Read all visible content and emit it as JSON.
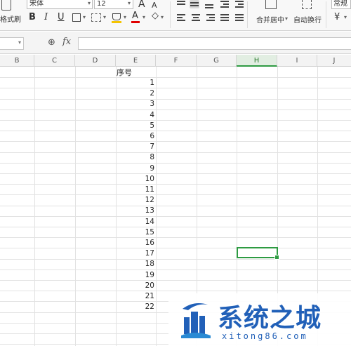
{
  "ribbon": {
    "format_painter_label": "格式刷",
    "font_name": "宋体",
    "font_size": "12",
    "bold_label": "B",
    "italic_label": "I",
    "underline_label": "U",
    "grow_font_label": "A",
    "shrink_font_label": "A",
    "merge_center_label": "合并居中",
    "wrap_text_label": "自动换行",
    "number_format_label": "常规",
    "currency_label": "¥"
  },
  "formula_bar": {
    "fx_label": "fx",
    "value": ""
  },
  "columns": [
    "B",
    "C",
    "D",
    "E",
    "F",
    "G",
    "H",
    "I",
    "J"
  ],
  "active_column": "H",
  "sheet": {
    "header": "序号",
    "numbers": [
      "1",
      "2",
      "3",
      "4",
      "5",
      "6",
      "7",
      "8",
      "9",
      "10",
      "11",
      "12",
      "13",
      "14",
      "15",
      "16",
      "17",
      "18",
      "19",
      "20",
      "21",
      "22"
    ]
  },
  "watermark": {
    "title": "系统之城",
    "url": "xitong86.com"
  },
  "colors": {
    "selection": "#2e9b42",
    "watermark": "#2160b8"
  }
}
